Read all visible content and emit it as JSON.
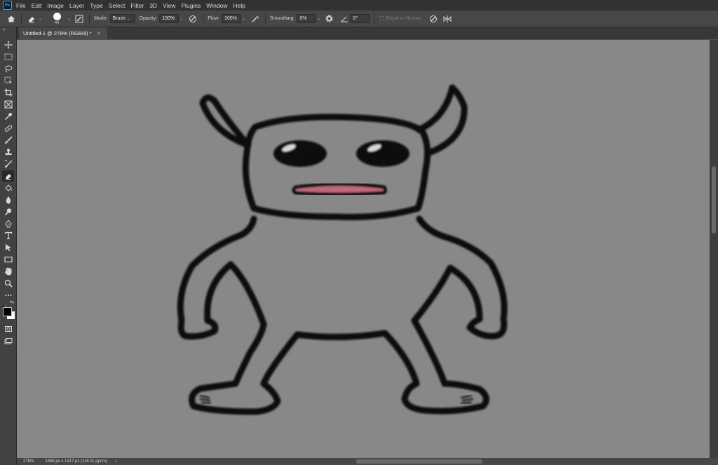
{
  "app": {
    "logo_text": "Ps"
  },
  "menu": [
    "File",
    "Edit",
    "Image",
    "Layer",
    "Type",
    "Select",
    "Filter",
    "3D",
    "View",
    "Plugins",
    "Window",
    "Help"
  ],
  "options": {
    "brush_size": "44",
    "mode_label": "Mode:",
    "mode_value": "Brush",
    "opacity_label": "Opacity:",
    "opacity_value": "100%",
    "flow_label": "Flow:",
    "flow_value": "100%",
    "smoothing_label": "Smoothing:",
    "smoothing_value": "0%",
    "angle_value": "0°",
    "erase_history_label": "Erase to History"
  },
  "document": {
    "tab_title": "Untitled-1 @ 278% (RGB/8) *",
    "close": "×"
  },
  "status": {
    "zoom": "278%",
    "doc_info": "1458 px x 1417 px (118.11 ppcm)",
    "arrow": "›"
  },
  "colors": {
    "accent": "#31a8ff",
    "canvas": "#888888",
    "ink": "#0b0b0b",
    "mouth": "#c06a79"
  },
  "icons": [
    "home-icon",
    "eraser-icon",
    "brush-preset-icon",
    "brush-settings-icon",
    "pressure-opacity-icon",
    "airbrush-icon",
    "gear-icon",
    "angle-icon",
    "pressure-size-icon",
    "symmetry-icon"
  ]
}
